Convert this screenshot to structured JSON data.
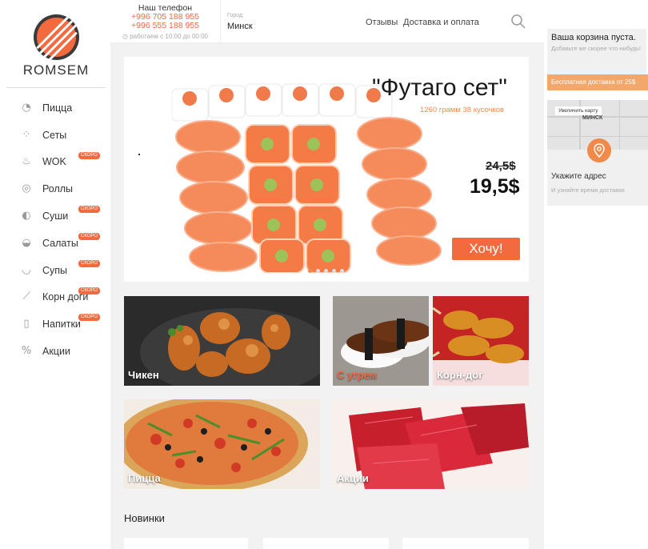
{
  "brand": {
    "name": "ROMSEM"
  },
  "header": {
    "phone_title": "Наш телефон",
    "phones": [
      "+996 705 188 955",
      "+996 555 188 955"
    ],
    "hours": "работаем с 10:00 до 00:00",
    "city_label": "Город:",
    "city_value": "Минск",
    "links": [
      "Отзывы",
      "Доставка и оплата"
    ]
  },
  "sidebar": {
    "items": [
      {
        "label": "Пицца",
        "badge": ""
      },
      {
        "label": "Сеты",
        "badge": ""
      },
      {
        "label": "WOK",
        "badge": "СКОРО"
      },
      {
        "label": "Роллы",
        "badge": ""
      },
      {
        "label": "Суши",
        "badge": "СКОРО"
      },
      {
        "label": "Салаты",
        "badge": "СКОРО"
      },
      {
        "label": "Супы",
        "badge": "СКОРО"
      },
      {
        "label": "Корн доги",
        "badge": "СКОРО"
      },
      {
        "label": "Напитки",
        "badge": "СКОРО"
      },
      {
        "label": "Акции",
        "badge": ""
      }
    ]
  },
  "cart": {
    "title": "Ваша корзина пуста.",
    "subtitle": "Добавьте же скорее что-нибудь!",
    "free_delivery": "Бесплатная доставка от 25$"
  },
  "map": {
    "button": "Увеличить карту",
    "city_label": "МИНСК",
    "title": "Укажите адрес",
    "subtitle": "И узнайте время доставки"
  },
  "banner": {
    "title": "\"Футаго сет\"",
    "subtitle": "1260 грамм 38 кусочков",
    "old_price": "24,5$",
    "new_price": "19,5$",
    "cta": "Хочу!"
  },
  "tiles": [
    "Чикен",
    "С угрем",
    "Корн-дог",
    "Пицца",
    "Акции"
  ],
  "new_section": {
    "title": "Новинки"
  },
  "colors": {
    "accent": "#f26a3d",
    "accent_light": "#f4a76b"
  }
}
